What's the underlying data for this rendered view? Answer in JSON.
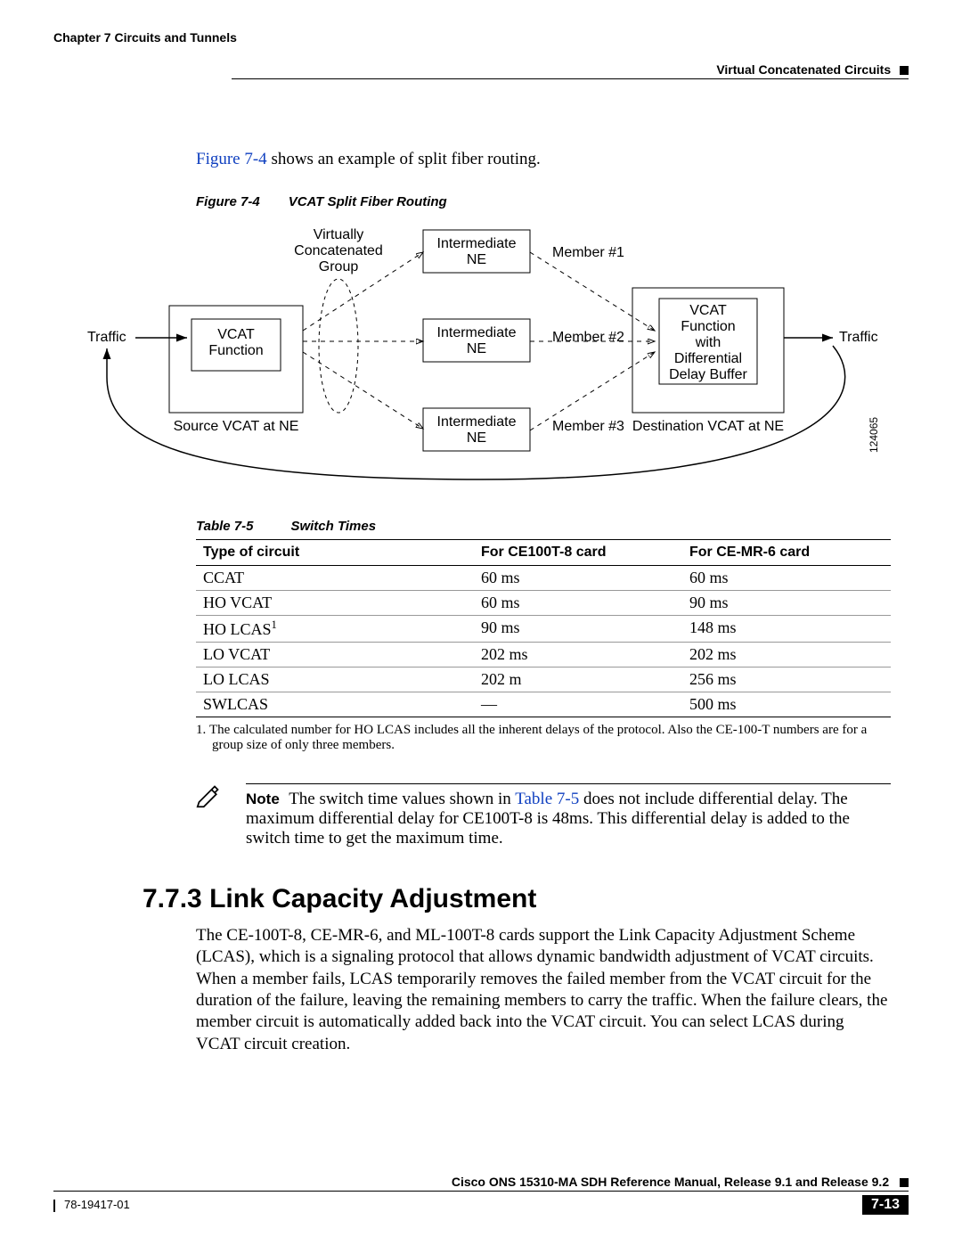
{
  "header": {
    "chapter": "Chapter 7    Circuits and Tunnels",
    "section": "Virtual Concatenated Circuits"
  },
  "intro": {
    "link": "Figure 7-4",
    "rest": " shows an example of split fiber routing."
  },
  "figure": {
    "label": "Figure 7-4",
    "title": "VCAT Split Fiber Routing",
    "traffic_left": "Traffic",
    "traffic_right": "Traffic",
    "vcg_l1": "Virtually",
    "vcg_l2": "Concatenated",
    "vcg_l3": "Group",
    "vcat_func_l1": "VCAT",
    "vcat_func_l2": "Function",
    "source_label": "Source VCAT at NE",
    "inter_l1": "Intermediate",
    "inter_l2": "NE",
    "member1": "Member #1",
    "member2": "Member #2",
    "member3": "Member #3",
    "dest_box_l1": "VCAT",
    "dest_box_l2": "Function",
    "dest_box_l3": "with",
    "dest_box_l4": "Differential",
    "dest_box_l5": "Delay Buffer",
    "dest_label": "Destination VCAT at NE",
    "sidecode": "124065"
  },
  "table": {
    "label": "Table 7-5",
    "title": "Switch Times",
    "headers": [
      "Type of circuit",
      "For CE100T-8 card",
      "For CE-MR-6 card"
    ],
    "rows": [
      {
        "c0": "CCAT",
        "c1": "60 ms",
        "c2": "60 ms"
      },
      {
        "c0": "HO VCAT",
        "c1": "60 ms",
        "c2": "90 ms"
      },
      {
        "c0": "HO LCAS",
        "sup": "1",
        "c1": "90 ms",
        "c2": "148 ms"
      },
      {
        "c0": "LO VCAT",
        "c1": "202 ms",
        "c2": "202 ms"
      },
      {
        "c0": "LO LCAS",
        "c1": "202 m",
        "c2": "256 ms"
      },
      {
        "c0": "SWLCAS",
        "c1": "—",
        "c2": "500 ms"
      }
    ],
    "footnote_num": "1.",
    "footnote": "The calculated number for HO LCAS includes all the inherent delays of the protocol. Also the CE-100-T numbers are for a group size of only three members."
  },
  "note": {
    "label": "Note",
    "pre": "The switch time values shown in ",
    "link": "Table 7-5",
    "post": " does not include differential delay. The maximum differential delay for CE100T-8 is 48ms. This differential delay is added to the switch time to get the maximum time."
  },
  "section": {
    "number": "7.7.3",
    "title": "Link Capacity Adjustment",
    "body": "The CE-100T-8, CE-MR-6, and ML-100T-8 cards support the Link Capacity Adjustment Scheme (LCAS), which is a signaling protocol that allows dynamic bandwidth adjustment of VCAT circuits. When a member fails, LCAS temporarily removes the failed member from the VCAT circuit for the duration of the failure, leaving the remaining members to carry the traffic. When the failure clears, the member circuit is automatically added back into the VCAT circuit. You can select LCAS during VCAT circuit creation."
  },
  "footer": {
    "manual": "Cisco ONS 15310-MA SDH Reference Manual, Release 9.1 and Release 9.2",
    "docnum": "78-19417-01",
    "page": "7-13"
  }
}
